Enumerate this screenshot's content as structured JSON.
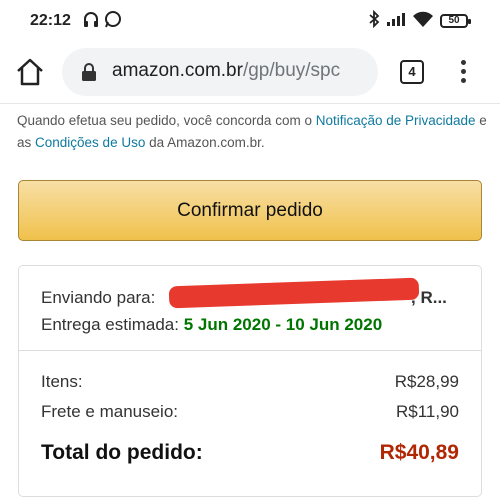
{
  "status_bar": {
    "time": "22:12",
    "battery": "50"
  },
  "browser": {
    "url_host": "amazon.com.br",
    "url_path": "/gp/buy/spc",
    "tab_count": "4"
  },
  "agreement": {
    "prefix": "Quando efetua seu pedido, você concorda com o ",
    "privacy_link": "Notificação de Privacidade",
    "middle": " e as ",
    "terms_link": "Condições de Uso",
    "suffix": " da Amazon.com.br."
  },
  "confirm_button": "Confirmar pedido",
  "shipping": {
    "to_label": "Enviando para:",
    "to_tail": ", R...",
    "delivery_label": "Entrega estimada: ",
    "delivery_dates": "5 Jun 2020 - 10 Jun 2020"
  },
  "summary": {
    "items_label": "Itens:",
    "items_value": "R$28,99",
    "shipping_label": "Frete e manuseio:",
    "shipping_value": "R$11,90",
    "total_label": "Total do pedido:",
    "total_value": "R$40,89"
  },
  "colors": {
    "link": "#0f7a9f",
    "price": "#b12704",
    "delivery": "#007600",
    "button": "#f0c14b"
  }
}
